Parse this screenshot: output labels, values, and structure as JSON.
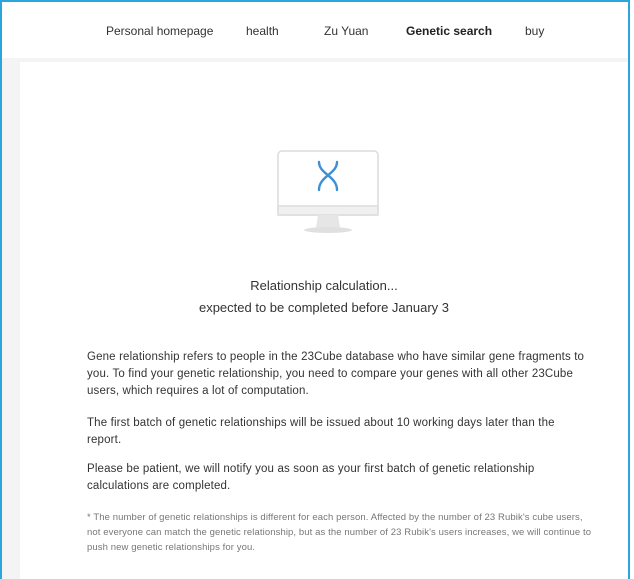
{
  "nav": {
    "items": [
      {
        "label": "Personal homepage"
      },
      {
        "label": "health"
      },
      {
        "label": "Zu Yuan"
      },
      {
        "label": "Genetic search"
      },
      {
        "label": "buy"
      }
    ],
    "active": "Genetic search"
  },
  "status": {
    "line1": "Relationship calculation...",
    "line2": "expected to be completed before January 3"
  },
  "paragraphs": [
    "Gene relationship refers to people in the 23Cube database who have similar gene fragments to you. To find your genetic relationship, you need to compare your genes with all other 23Cube users, which requires a lot of computation.",
    "The first batch of genetic relationships will be issued about 10 working days later than the report.",
    "Please be patient, we will notify you as soon as your first batch of genetic relationship calculations are completed."
  ],
  "footnote": "* The number of genetic relationships is different for each person. Affected by the number of 23 Rubik's cube users, not everyone can match the genetic relationship, but as the number of 23 Rubik's users increases, we will continue to push new genetic relationships for you.",
  "icons": {
    "monitor": "monitor-icon",
    "dna": "dna-icon"
  },
  "colors": {
    "frame_border": "#2aa6dc",
    "dna_blue": "#3f8fd6",
    "background": "#f4f4f4"
  }
}
